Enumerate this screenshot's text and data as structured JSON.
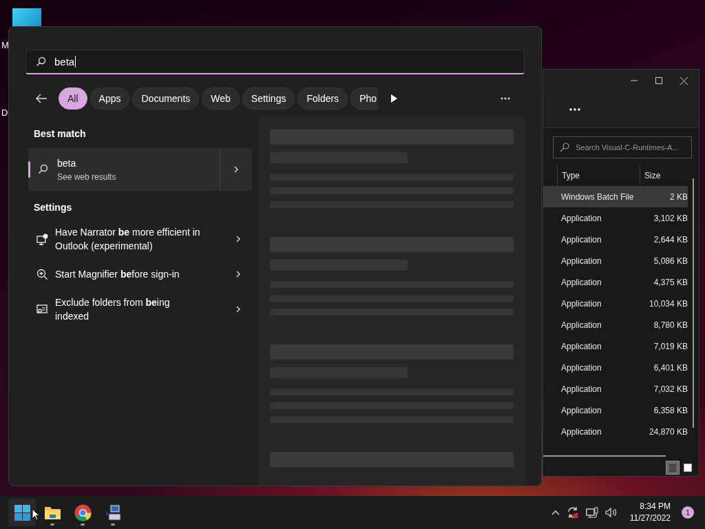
{
  "desktop_icons": [
    {
      "label": "M"
    },
    {
      "label": "D"
    }
  ],
  "search": {
    "query": "beta",
    "filters": [
      {
        "label": "All",
        "selected": true
      },
      {
        "label": "Apps",
        "selected": false
      },
      {
        "label": "Documents",
        "selected": false
      },
      {
        "label": "Web",
        "selected": false
      },
      {
        "label": "Settings",
        "selected": false
      },
      {
        "label": "Folders",
        "selected": false
      },
      {
        "label": "Pho",
        "selected": false
      }
    ],
    "best_match": {
      "heading": "Best match",
      "title": "beta",
      "subtitle": "See web results",
      "selected": true
    },
    "settings": {
      "heading": "Settings",
      "items": [
        {
          "kind": "narrator",
          "text": "Have Narrator **be** more efficient in Outlook (experimental)"
        },
        {
          "kind": "magnifier",
          "text": "Start Magnifier **be**fore sign-in"
        },
        {
          "kind": "indexing",
          "text": "Exclude folders from **be**ing indexed"
        }
      ]
    }
  },
  "explorer": {
    "search_placeholder": "Search Visual-C-Runtimes-A...",
    "columns": [
      "Type",
      "Size"
    ],
    "rows": [
      {
        "type": "Windows Batch File",
        "size": "2 KB",
        "selected": true
      },
      {
        "type": "Application",
        "size": "3,102 KB",
        "selected": false
      },
      {
        "type": "Application",
        "size": "2,644 KB",
        "selected": false
      },
      {
        "type": "Application",
        "size": "5,086 KB",
        "selected": false
      },
      {
        "type": "Application",
        "size": "4,375 KB",
        "selected": false
      },
      {
        "type": "Application",
        "size": "10,034 KB",
        "selected": false
      },
      {
        "type": "Application",
        "size": "8,780 KB",
        "selected": false
      },
      {
        "type": "Application",
        "size": "7,019 KB",
        "selected": false
      },
      {
        "type": "Application",
        "size": "6,401 KB",
        "selected": false
      },
      {
        "type": "Application",
        "size": "7,032 KB",
        "selected": false
      },
      {
        "type": "Application",
        "size": "6,358 KB",
        "selected": false
      },
      {
        "type": "Application",
        "size": "24,870 KB",
        "selected": false
      }
    ],
    "views": [
      {
        "kind": "details",
        "selected": true
      },
      {
        "kind": "tiles",
        "selected": false
      }
    ]
  },
  "taskbar": {
    "apps": [
      {
        "kind": "start",
        "running": false
      },
      {
        "kind": "explorer",
        "running": true
      },
      {
        "kind": "chrome",
        "running": true
      },
      {
        "kind": "installer",
        "running": true
      }
    ],
    "time": "8:34 PM",
    "date": "11/27/2022",
    "notifications": "1"
  }
}
